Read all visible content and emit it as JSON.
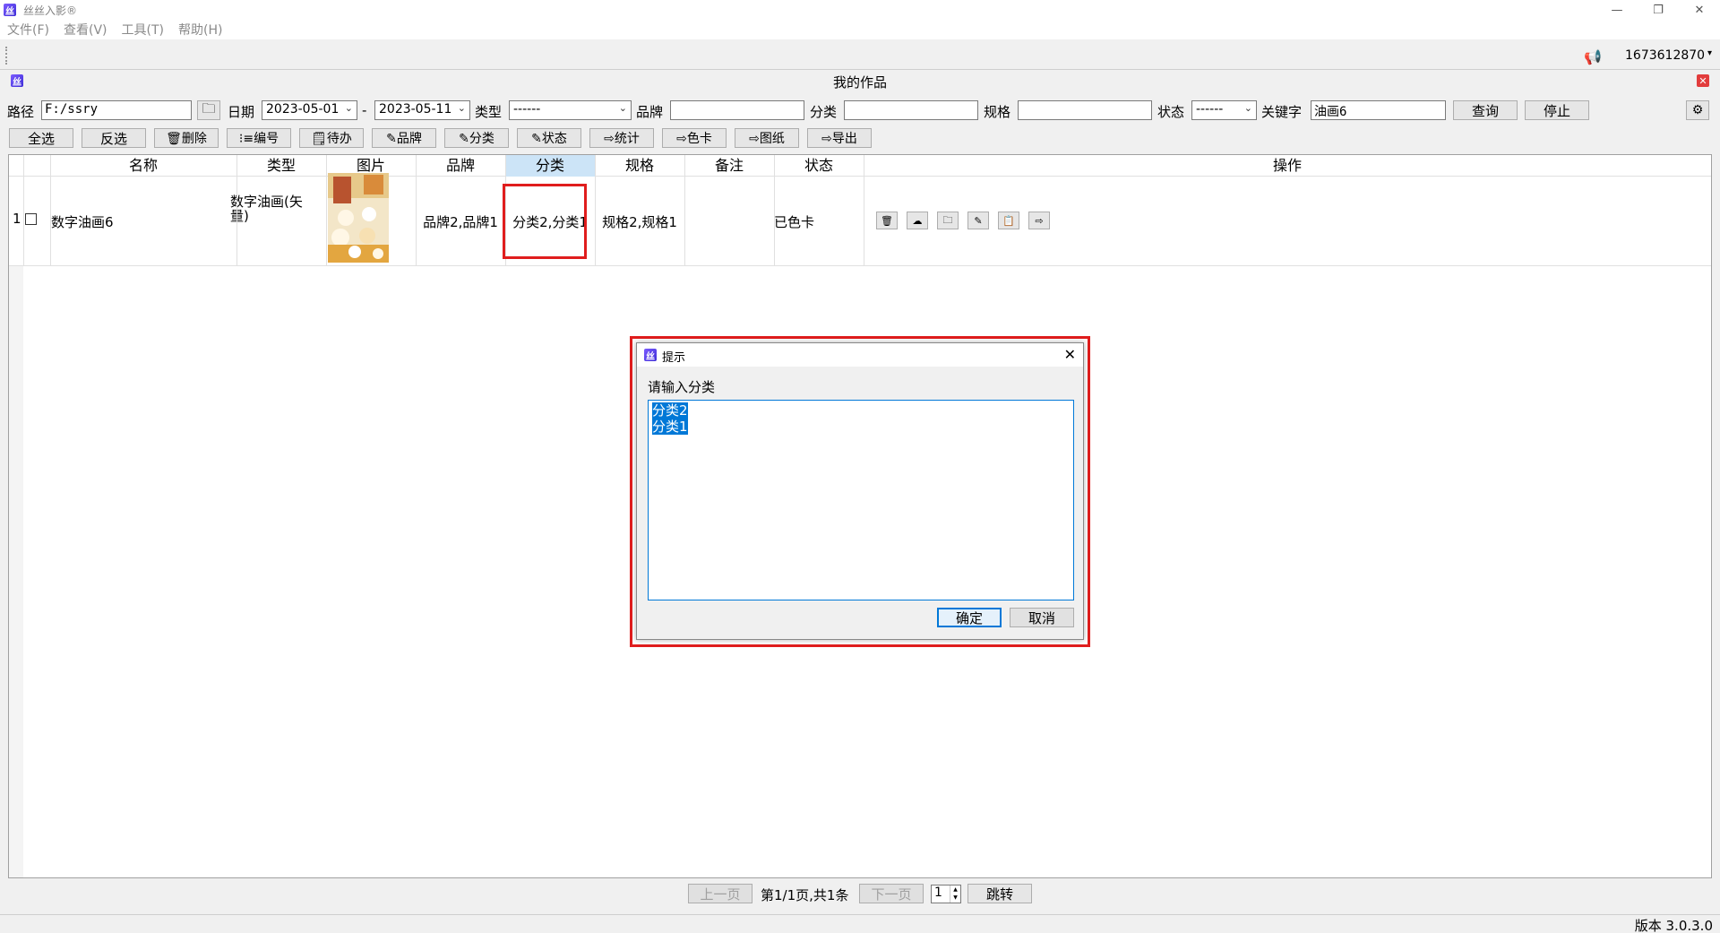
{
  "app": {
    "title": "丝丝入影®",
    "win_minimize": "—",
    "win_restore": "❐",
    "win_close": "✕"
  },
  "menu": [
    "文件(F)",
    "查看(V)",
    "工具(T)",
    "帮助(H)"
  ],
  "topstrip": {
    "account": "1673612870",
    "account_arrow": "▾"
  },
  "subwindow": {
    "title": "我的作品"
  },
  "filters": {
    "path_label": "路径",
    "path_value": "F:/ssry",
    "date_label": "日期",
    "date_start": "2023-05-01",
    "date_sep": "-",
    "date_end": "2023-05-11",
    "type_label": "类型",
    "type_value": "------",
    "brand_label": "品牌",
    "brand_value": "",
    "category_label": "分类",
    "category_value": "",
    "spec_label": "规格",
    "spec_value": "",
    "status_label": "状态",
    "status_value": "------",
    "keyword_label": "关键字",
    "keyword_value": "油画6",
    "query_btn": "查询",
    "stop_btn": "停止"
  },
  "toolbar": [
    "全选",
    "反选",
    "🗑删除",
    "⁝≡编号",
    "🗒待办",
    "✎品牌",
    "✎分类",
    "✎状态",
    "⇨统计",
    "⇨色卡",
    "⇨图纸",
    "⇨导出"
  ],
  "table": {
    "headers": [
      "名称",
      "类型",
      "图片",
      "品牌",
      "分类",
      "规格",
      "备注",
      "状态",
      "操作"
    ],
    "rows": [
      {
        "index": "1",
        "name": "数字油画6",
        "type": "数字油画(矢量)",
        "brand": "品牌2,品牌1",
        "category": "分类2,分类1",
        "spec": "规格2,规格1",
        "note": "",
        "status": "已色卡"
      }
    ]
  },
  "pager": {
    "prev": "上一页",
    "info": "第1/1页,共1条",
    "next": "下一页",
    "page": "1",
    "jump": "跳转"
  },
  "status": {
    "version": "版本 3.0.3.0"
  },
  "dialog": {
    "title": "提示",
    "prompt": "请输入分类",
    "lines": [
      "分类2",
      "分类1"
    ],
    "ok": "确定",
    "cancel": "取消"
  },
  "colors": {
    "highlight": "#e01d1d",
    "selection": "#0078d7",
    "active_header": "#cce4f7"
  }
}
